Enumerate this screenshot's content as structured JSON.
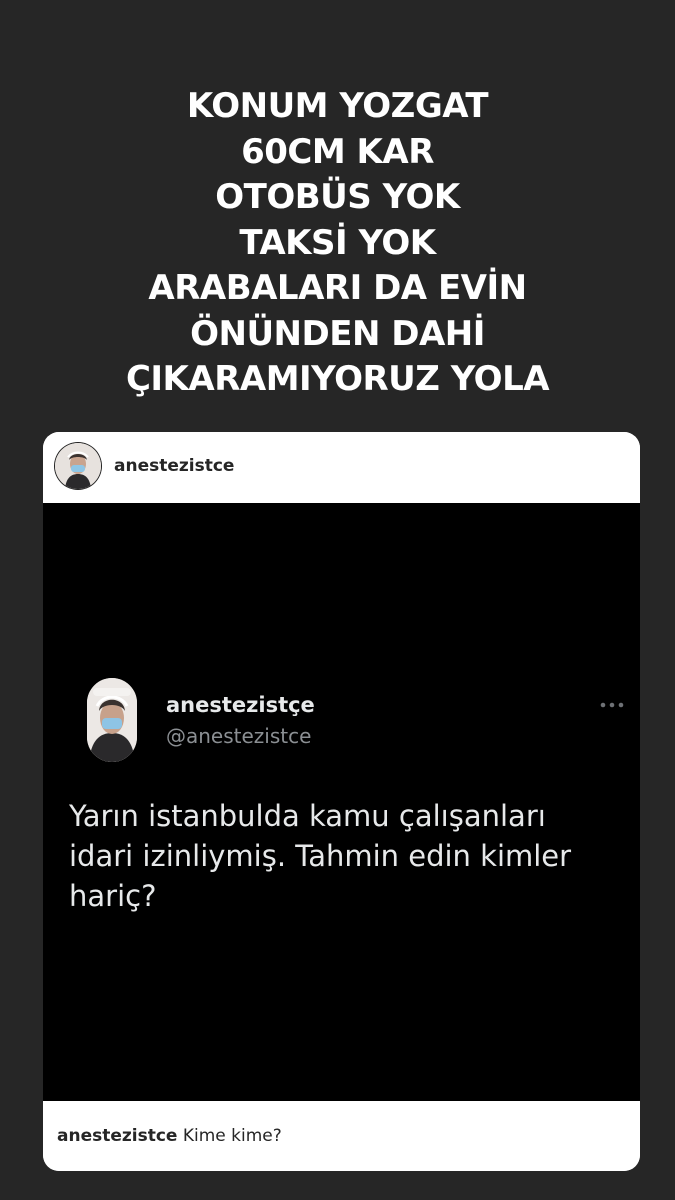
{
  "story": {
    "lines": [
      "KONUM YOZGAT",
      "60CM KAR",
      "OTOBÜS YOK",
      "TAKSİ YOK",
      "ARABALARI DA EVİN",
      "ÖNÜNDEN DAHİ",
      "ÇIKARAMIYORUZ YOLA"
    ]
  },
  "post": {
    "username": "anestezistce",
    "avatar_icon": "profile-photo-masked-person"
  },
  "tweet": {
    "display_name": "anestezistçe",
    "handle": "@anestezistce",
    "text": "Yarın istanbulda kamu çalışanları idari izinliymiş. Tahmin edin kimler hariç?",
    "more_icon": "more-horizontal-icon"
  },
  "caption": {
    "username": "anestezistce",
    "text": "Kime kime?"
  },
  "colors": {
    "background": "#262626",
    "card": "#ffffff",
    "tweet_background": "#000000",
    "tweet_text": "#e7e9ea",
    "tweet_handle": "#8b8f93"
  }
}
